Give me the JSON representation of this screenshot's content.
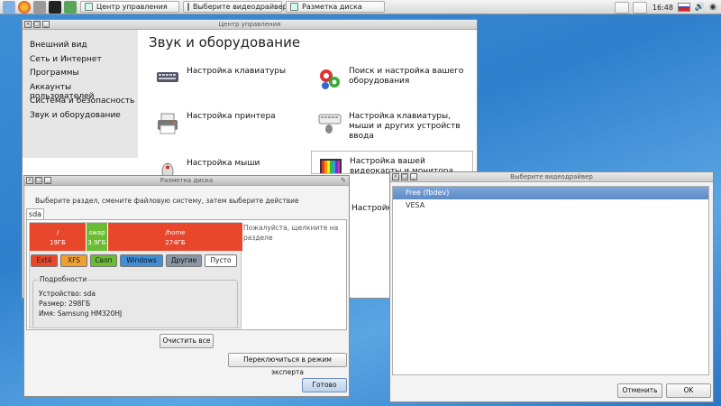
{
  "taskbar": {
    "tasks": [
      "Центр управления",
      "Выберите видеодрайвер",
      "Разметка диска"
    ],
    "clock": "16:48"
  },
  "control_center": {
    "title": "Центр управления",
    "heading": "Звук и оборудование",
    "sidebar": [
      "Внешний вид",
      "Сеть и Интернет",
      "Программы",
      "Аккаунты пользователей",
      "Система и безопасность",
      "Звук и оборудование"
    ],
    "items": [
      {
        "label1": "Настройка клавиатуры",
        "label2": ""
      },
      {
        "label1": "Поиск и настройка вашего",
        "label2": "оборудования"
      },
      {
        "label1": "Настройка принтера",
        "label2": ""
      },
      {
        "label1": "Настройка клавиатуры,",
        "label2": "мыши и других устройств",
        "label3": "ввода"
      },
      {
        "label1": "Настройка мыши",
        "label2": ""
      },
      {
        "label1": "Настройка вашей",
        "label2": "видеокарты и монитора"
      },
      {
        "label1": "Настройк",
        "label2": ""
      }
    ]
  },
  "partition": {
    "title": "Разметка диска",
    "hint": "Выберите раздел, смените файловую систему, затем выберите действие",
    "tab": "sda",
    "partitions": [
      {
        "mount": "/",
        "size": "19ГБ",
        "color": "#e8472c"
      },
      {
        "mount": "swap",
        "size": "3.9ГБ",
        "color": "#6bbb33"
      },
      {
        "mount": "/home",
        "size": "274ГБ",
        "color": "#e8472c"
      }
    ],
    "fs_types": [
      {
        "label": "Ext4",
        "color": "#e8472c",
        "text": "#222"
      },
      {
        "label": "XFS",
        "color": "#f0a030",
        "text": "#222"
      },
      {
        "label": "Своп",
        "color": "#6bbb33",
        "text": "#222"
      },
      {
        "label": "Windows",
        "color": "#3f8fd6",
        "text": "#111"
      },
      {
        "label": "Другие",
        "color": "#8a96a4",
        "text": "#111"
      },
      {
        "label": "Пусто",
        "color": "#ffffff",
        "text": "#222"
      }
    ],
    "details_label": "Подробности",
    "details": [
      "Устройство: sda",
      "Размер: 298ГБ",
      "Имя: Samsung HM320HJ"
    ],
    "note": "Пожалуйста, щелкните на разделе",
    "clear_button": "Очистить все",
    "expert_button": "Переключиться в режим эксперта",
    "done_button": "Готово"
  },
  "driver": {
    "title": "Выберите видеодрайвер",
    "options": [
      "Free (fbdev)",
      "VESA"
    ],
    "cancel_button": "Отменить",
    "ok_button": "OK"
  }
}
